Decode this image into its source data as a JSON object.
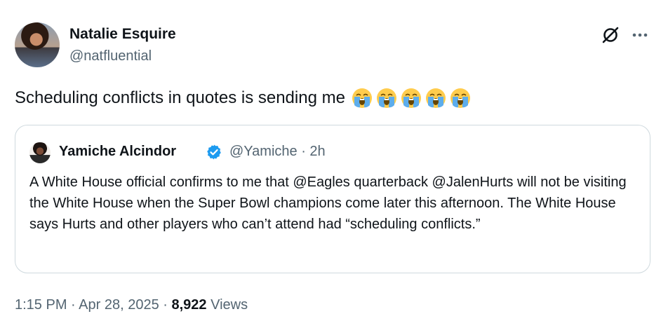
{
  "author": {
    "name": "Natalie Esquire",
    "handle": "@natfluential"
  },
  "tweet": {
    "text": "Scheduling conflicts in quotes is sending me",
    "emoji": [
      "loudly-crying-face",
      "loudly-crying-face",
      "loudly-crying-face",
      "loudly-crying-face",
      "loudly-crying-face"
    ]
  },
  "quoted": {
    "name": "Yamiche Alcindor",
    "handle_time": "@Yamiche · 2h",
    "verified": true,
    "text": "A White House official confirms to me that @Eagles quarterback @JalenHurts will not be visiting the White House when the Super Bowl champions come later this afternoon. The White House says Hurts and other players who can’t attend had “scheduling conflicts.”"
  },
  "meta": {
    "time": "1:15 PM",
    "date": "Apr 28, 2025",
    "separator": " · ",
    "views_count": "8,922",
    "views_label": "Views"
  },
  "icons": {
    "grok": "grok-icon",
    "more": "more-icon",
    "verified": "verified-badge-icon"
  },
  "colors": {
    "text": "#0f1419",
    "secondary": "#536471",
    "border": "#cfd9de",
    "verified": "#1d9bf0"
  }
}
